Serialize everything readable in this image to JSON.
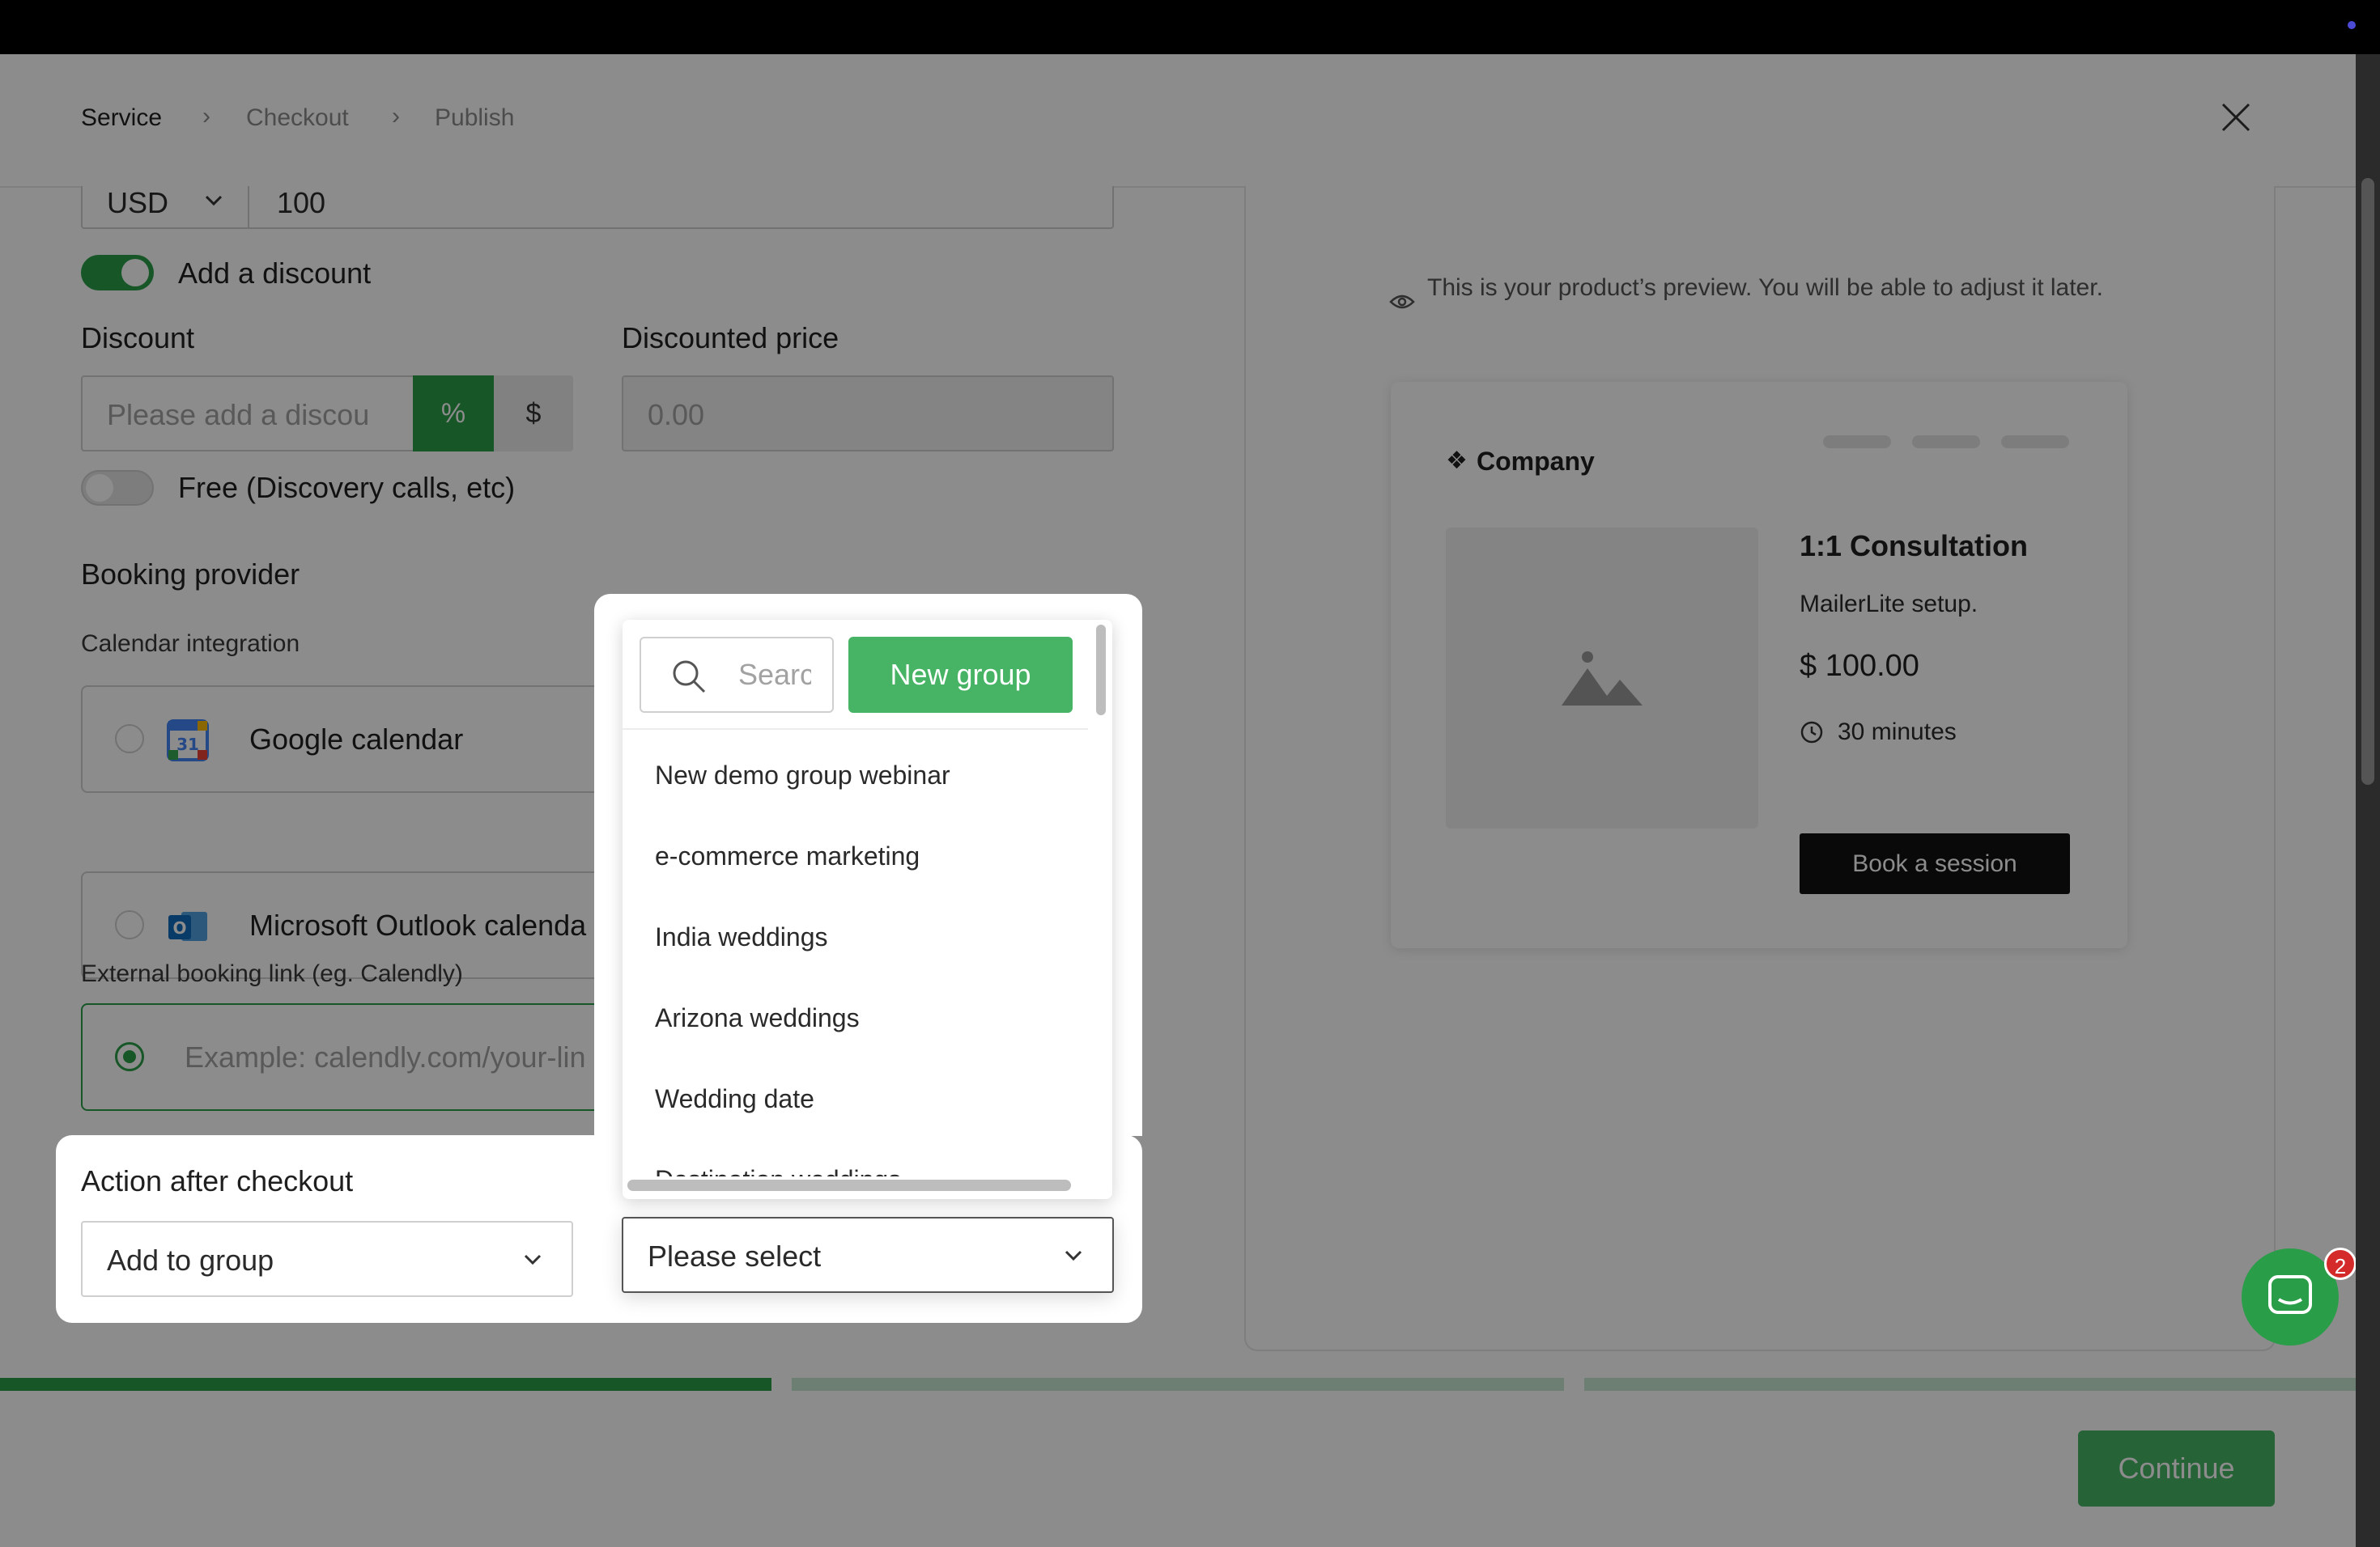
{
  "breadcrumb": {
    "step1": "Service",
    "step2": "Checkout",
    "step3": "Publish"
  },
  "pricing": {
    "currency": "USD",
    "price": "100"
  },
  "discount": {
    "toggle_label": "Add a discount",
    "discount_label": "Discount",
    "discount_placeholder": "Please add a discou",
    "percent_label": "%",
    "dollar_label": "$",
    "discounted_price_label": "Discounted price",
    "discounted_price_placeholder": "0.00"
  },
  "free": {
    "label": "Free (Discovery calls, etc)"
  },
  "booking": {
    "title": "Booking provider",
    "calendar_label": "Calendar integration",
    "google": "Google calendar",
    "outlook": "Microsoft Outlook calenda",
    "external_label": "External booking link (eg. Calendly)",
    "external_placeholder": "Example: calendly.com/your-lin"
  },
  "action": {
    "title": "Action after checkout",
    "selected": "Add to group",
    "group_placeholder": "Please select"
  },
  "dropdown": {
    "search_placeholder": "Search",
    "new_group": "New group",
    "items": [
      "New demo group webinar",
      "e-commerce marketing",
      "India weddings",
      "Arizona weddings",
      "Wedding date",
      "Destination weddings"
    ]
  },
  "preview": {
    "note": "This is your product’s preview. You will be able to adjust it later.",
    "company": "Company",
    "product_title": "1:1 Consultation",
    "product_subtitle": "MailerLite setup.",
    "price": "$ 100.00",
    "duration": "30 minutes",
    "book_button": "Book a session"
  },
  "footer": {
    "continue": "Continue"
  },
  "chat": {
    "badge": "2"
  },
  "progress_steps": [
    1,
    0,
    0
  ],
  "colors": {
    "accent": "#2a9d48",
    "button_green": "#46b464",
    "progress_light": "#c6e6cf"
  }
}
